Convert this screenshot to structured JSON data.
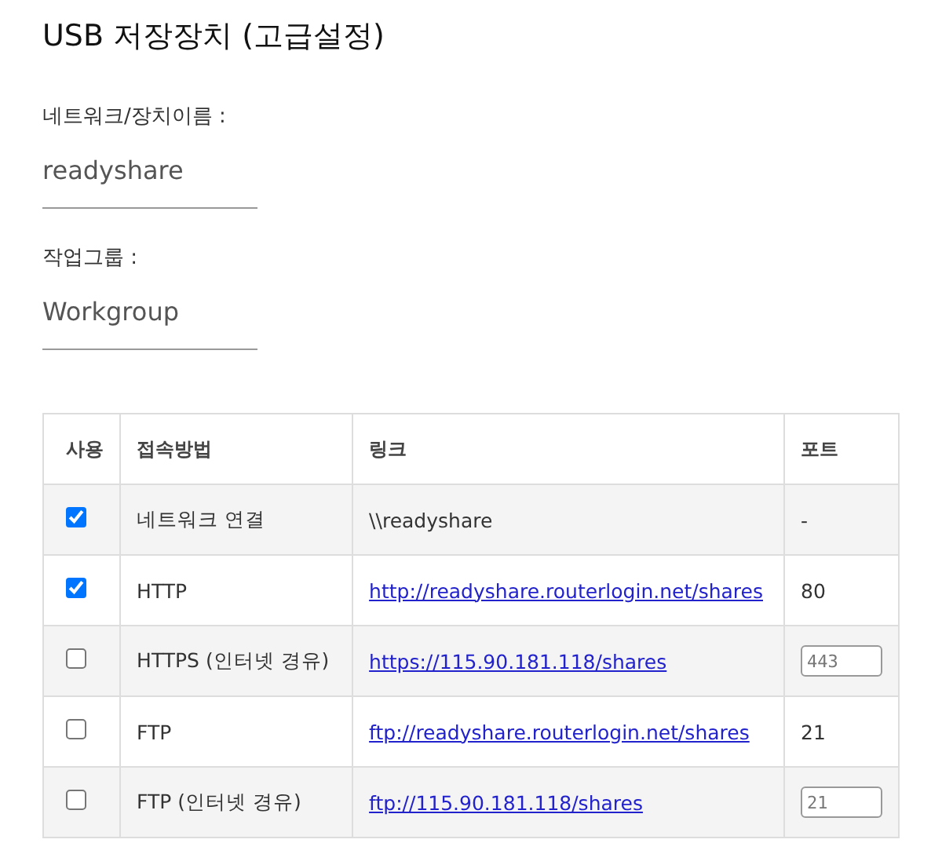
{
  "title": "USB 저장장치 (고급설정)",
  "fields": [
    {
      "label": "네트워크/장치이름 :",
      "value": "readyshare"
    },
    {
      "label": "작업그룹 :",
      "value": "Workgroup"
    }
  ],
  "table": {
    "columns": [
      "사용",
      "접속방법",
      "링크",
      "포트"
    ],
    "rows": [
      {
        "checked": true,
        "method": "네트워크 연결",
        "link": {
          "kind": "text",
          "text": "\\\\readyshare"
        },
        "port": {
          "kind": "text",
          "text": "-"
        }
      },
      {
        "checked": true,
        "method": "HTTP",
        "link": {
          "kind": "link",
          "text": "http://readyshare.routerlogin.net/shares"
        },
        "port": {
          "kind": "text",
          "text": "80"
        }
      },
      {
        "checked": false,
        "method": "HTTPS (인터넷 경유)",
        "link": {
          "kind": "link",
          "text": "https://115.90.181.118/shares"
        },
        "port": {
          "kind": "field",
          "text": "443"
        }
      },
      {
        "checked": false,
        "method": "FTP",
        "link": {
          "kind": "link",
          "text": "ftp://readyshare.routerlogin.net/shares"
        },
        "port": {
          "kind": "text",
          "text": "21"
        }
      },
      {
        "checked": false,
        "method": "FTP (인터넷 경유)",
        "link": {
          "kind": "link",
          "text": "ftp://115.90.181.118/shares"
        },
        "port": {
          "kind": "field",
          "text": "21"
        }
      }
    ]
  }
}
